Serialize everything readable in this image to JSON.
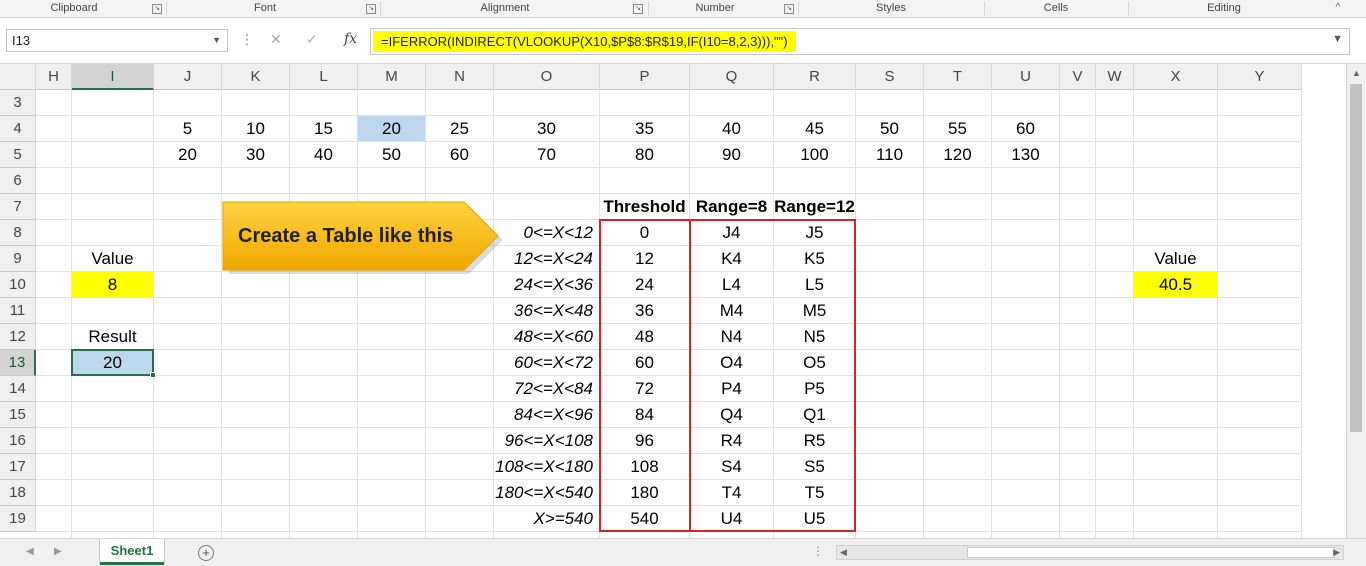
{
  "ribbon": {
    "groups": [
      "Clipboard",
      "Font",
      "Alignment",
      "Number",
      "Styles",
      "Cells",
      "Editing"
    ]
  },
  "formula_bar": {
    "name_box": "I13",
    "fx_label": "fx",
    "formula": "=IFERROR(INDIRECT(VLOOKUP(X10,$P$8:$R$19,IF(I10=8,2,3))),\"\")"
  },
  "columns": [
    "H",
    "I",
    "J",
    "K",
    "L",
    "M",
    "N",
    "O",
    "P",
    "Q",
    "R",
    "S",
    "T",
    "U",
    "V",
    "W",
    "X",
    "Y"
  ],
  "rows": [
    "3",
    "4",
    "5",
    "6",
    "7",
    "8",
    "9",
    "10",
    "11",
    "12",
    "13",
    "14",
    "15",
    "16",
    "17",
    "18",
    "19"
  ],
  "selected": {
    "column": "I",
    "row": "13"
  },
  "sheet": {
    "row4": [
      "5",
      "10",
      "15",
      "20",
      "25",
      "30",
      "35",
      "40",
      "45",
      "50",
      "55",
      "60"
    ],
    "row5": [
      "20",
      "30",
      "40",
      "50",
      "60",
      "70",
      "80",
      "90",
      "100",
      "110",
      "120",
      "130"
    ],
    "highlight_cell": "M4",
    "value_label": "Value",
    "value_input": "8",
    "result_label": "Result",
    "result_value": "20",
    "x_value_label": "Value",
    "x_value_input": "40.5",
    "table": {
      "headers": [
        "Threshold",
        "Range=8",
        "Range=12"
      ],
      "rows": [
        {
          "label": "0<=X<12",
          "threshold": "0",
          "r8": "J4",
          "r12": "J5"
        },
        {
          "label": "12<=X<24",
          "threshold": "12",
          "r8": "K4",
          "r12": "K5"
        },
        {
          "label": "24<=X<36",
          "threshold": "24",
          "r8": "L4",
          "r12": "L5"
        },
        {
          "label": "36<=X<48",
          "threshold": "36",
          "r8": "M4",
          "r12": "M5"
        },
        {
          "label": "48<=X<60",
          "threshold": "48",
          "r8": "N4",
          "r12": "N5"
        },
        {
          "label": "60<=X<72",
          "threshold": "60",
          "r8": "O4",
          "r12": "O5"
        },
        {
          "label": "72<=X<84",
          "threshold": "72",
          "r8": "P4",
          "r12": "P5"
        },
        {
          "label": "84<=X<96",
          "threshold": "84",
          "r8": "Q4",
          "r12": "Q1"
        },
        {
          "label": "96<=X<108",
          "threshold": "96",
          "r8": "R4",
          "r12": "R5"
        },
        {
          "label": "108<=X<180",
          "threshold": "108",
          "r8": "S4",
          "r12": "S5"
        },
        {
          "label": "180<=X<540",
          "threshold": "180",
          "r8": "T4",
          "r12": "T5"
        },
        {
          "label": "X>=540",
          "threshold": "540",
          "r8": "U4",
          "r12": "U5"
        }
      ]
    }
  },
  "callout": {
    "text": "Create a Table like this"
  },
  "tabs": {
    "sheet_name": "Sheet1"
  },
  "colors": {
    "yellow": "#ffff00",
    "selected_blue": "#bdd7ee",
    "excel_green": "#217346",
    "table_border": "#e02020",
    "callout_gold": "#f5b800"
  }
}
